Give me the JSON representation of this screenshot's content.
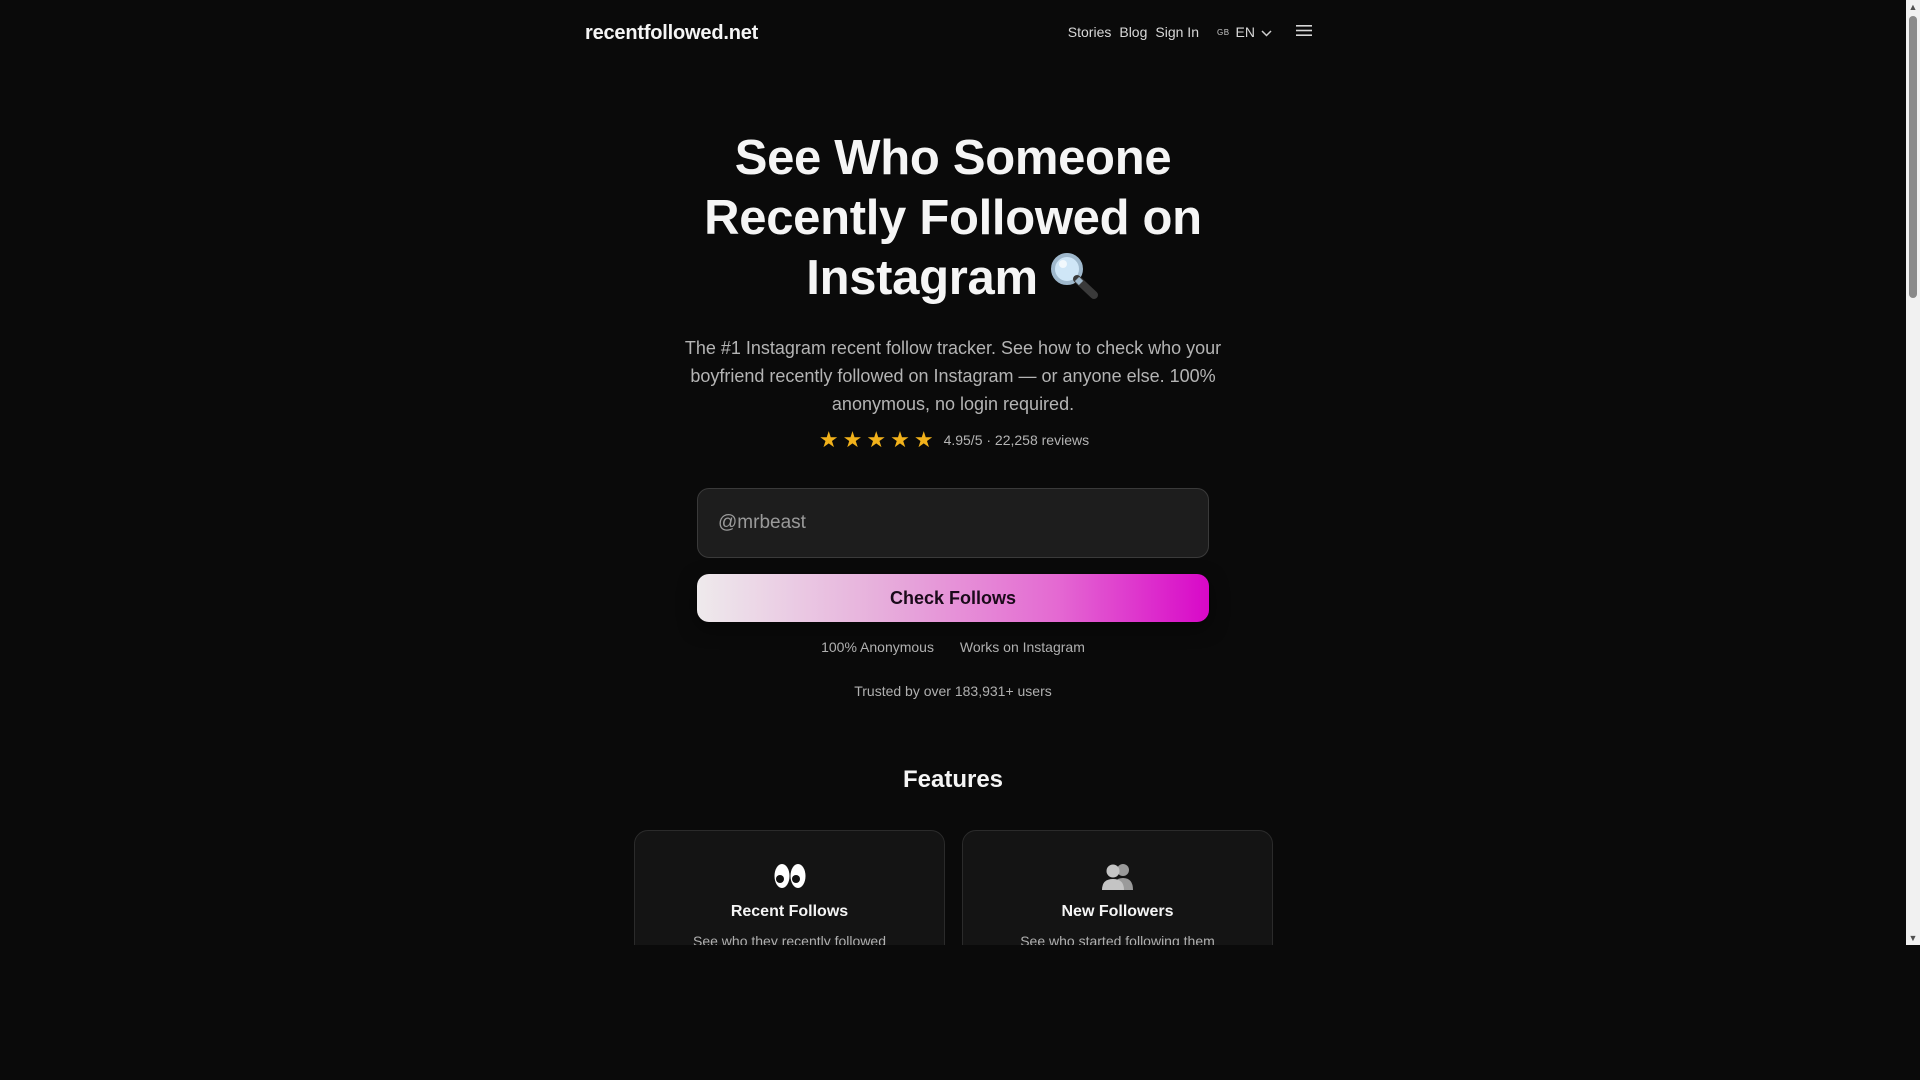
{
  "header": {
    "logo": "recentfollowed.net",
    "nav": [
      "Stories",
      "Blog",
      "Sign In"
    ],
    "language": {
      "flag_code": "GB",
      "label": "EN"
    },
    "menu_icon": "hamburger-menu-icon"
  },
  "hero": {
    "title_lines": [
      "See Who Someone",
      "Recently Followed on",
      "Instagram"
    ],
    "title_emoji": "magnifying-glass-icon",
    "subtitle": "The #1 Instagram recent follow tracker. See how to check who your boyfriend recently followed on Instagram — or anyone else. 100% anonymous, no login required."
  },
  "rating": {
    "stars": 5,
    "star_color": "#f2b21b",
    "text": "4.95/5 · 22,258 reviews"
  },
  "search": {
    "placeholder": "@mrbeast",
    "button_label": "Check Follows"
  },
  "badges": [
    "100% Anonymous",
    "Works on Instagram"
  ],
  "trusted_text": "Trusted by over 183,931+ users",
  "features": {
    "title": "Features",
    "cards": [
      {
        "icon": "eyes-icon",
        "title": "Recent Follows",
        "description": "See who they recently followed"
      },
      {
        "icon": "people-icon",
        "title": "New Followers",
        "description": "See who started following them"
      }
    ]
  },
  "colors": {
    "background": "#0a0a0a",
    "accent_gradient_end": "#d808c8",
    "star": "#f2b21b"
  }
}
